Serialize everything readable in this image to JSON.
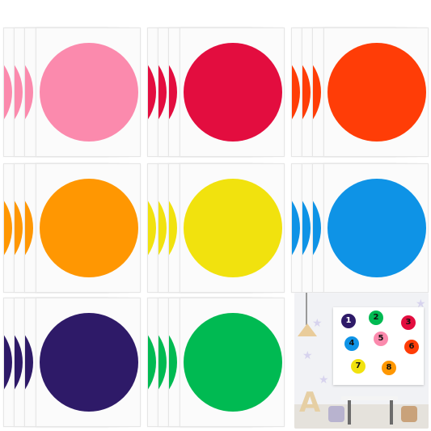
{
  "image": "Product photo: nine stacks of round color dot sticker sheets plus an inset room scene showing numbered dots on a wall board",
  "sheets": [
    {
      "name": "pink",
      "color": "#fb8aad"
    },
    {
      "name": "red",
      "color": "#e30d3f"
    },
    {
      "name": "orange-red",
      "color": "#ff3d07"
    },
    {
      "name": "orange",
      "color": "#ff9702"
    },
    {
      "name": "yellow",
      "color": "#f1e20e"
    },
    {
      "name": "blue",
      "color": "#0e93e6"
    },
    {
      "name": "purple",
      "color": "#2e1a68"
    },
    {
      "name": "green",
      "color": "#00ba52"
    }
  ],
  "inset": {
    "board_dots": [
      {
        "label": "1",
        "color": "#2e1a68"
      },
      {
        "label": "2",
        "color": "#00ba52"
      },
      {
        "label": "3",
        "color": "#e30d3f"
      },
      {
        "label": "4",
        "color": "#0e93e6"
      },
      {
        "label": "5",
        "color": "#fb8aad"
      },
      {
        "label": "6",
        "color": "#ff3d07"
      },
      {
        "label": "7",
        "color": "#f1e20e"
      },
      {
        "label": "8",
        "color": "#ff9702"
      }
    ]
  }
}
